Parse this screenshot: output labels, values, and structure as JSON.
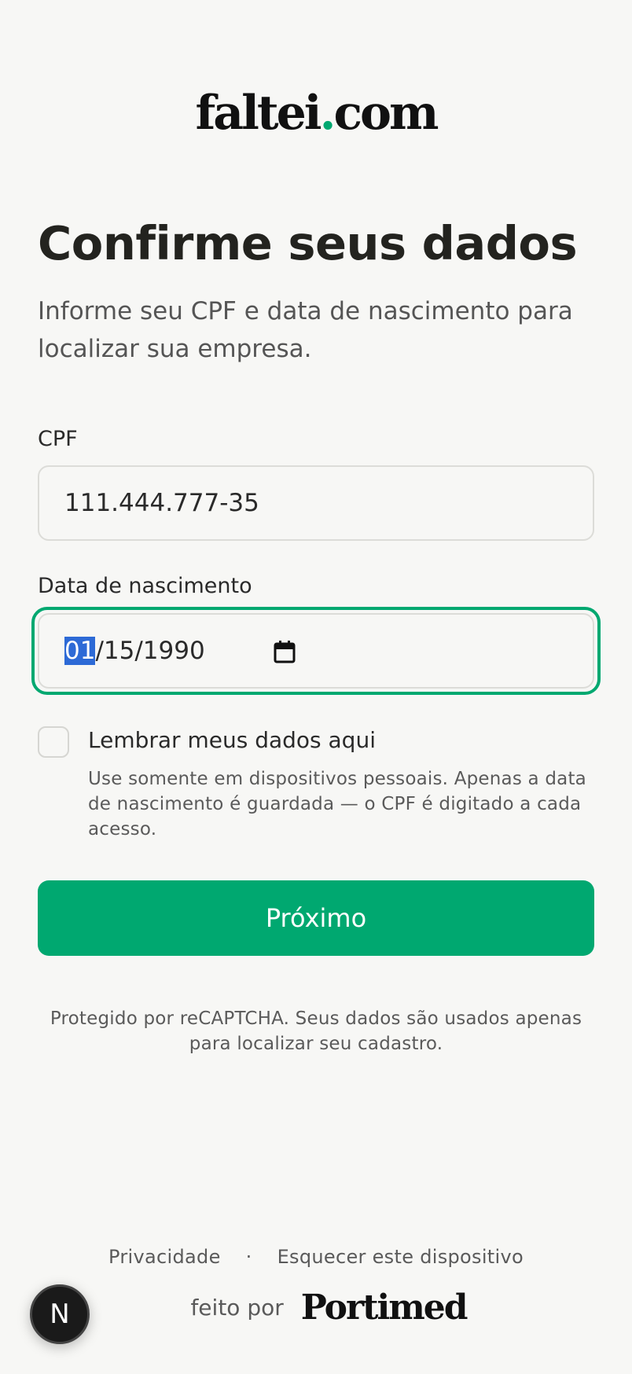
{
  "logo": {
    "prefix": "faltei",
    "dot": ".",
    "suffix": "com",
    "accent_color": "#00a870"
  },
  "header": {
    "title": "Confirme seus dados",
    "subtitle": "Informe seu CPF e data de nascimento para localizar sua empresa."
  },
  "form": {
    "cpf": {
      "label": "CPF",
      "value": "111.444.777-35"
    },
    "dob": {
      "label": "Data de nascimento",
      "month": "01",
      "rest": "/15/1990",
      "icon": "calendar-icon"
    },
    "remember": {
      "label": "Lembrar meus dados aqui",
      "checked": false,
      "help": "Use somente em dispositivos pessoais. Apenas a data de nascimento é guardada — o CPF é digitado a cada acesso."
    },
    "submit_label": "Próximo",
    "button_color": "#00a870"
  },
  "recaptcha_note": "Protegido por reCAPTCHA. Seus dados são usados apenas para localizar seu cadastro.",
  "footer": {
    "privacy": "Privacidade",
    "separator": "·",
    "forget_device": "Esquecer este dispositivo",
    "made_by": "feito por",
    "brand": "Portimed"
  },
  "dev_badge": {
    "letter": "N"
  }
}
